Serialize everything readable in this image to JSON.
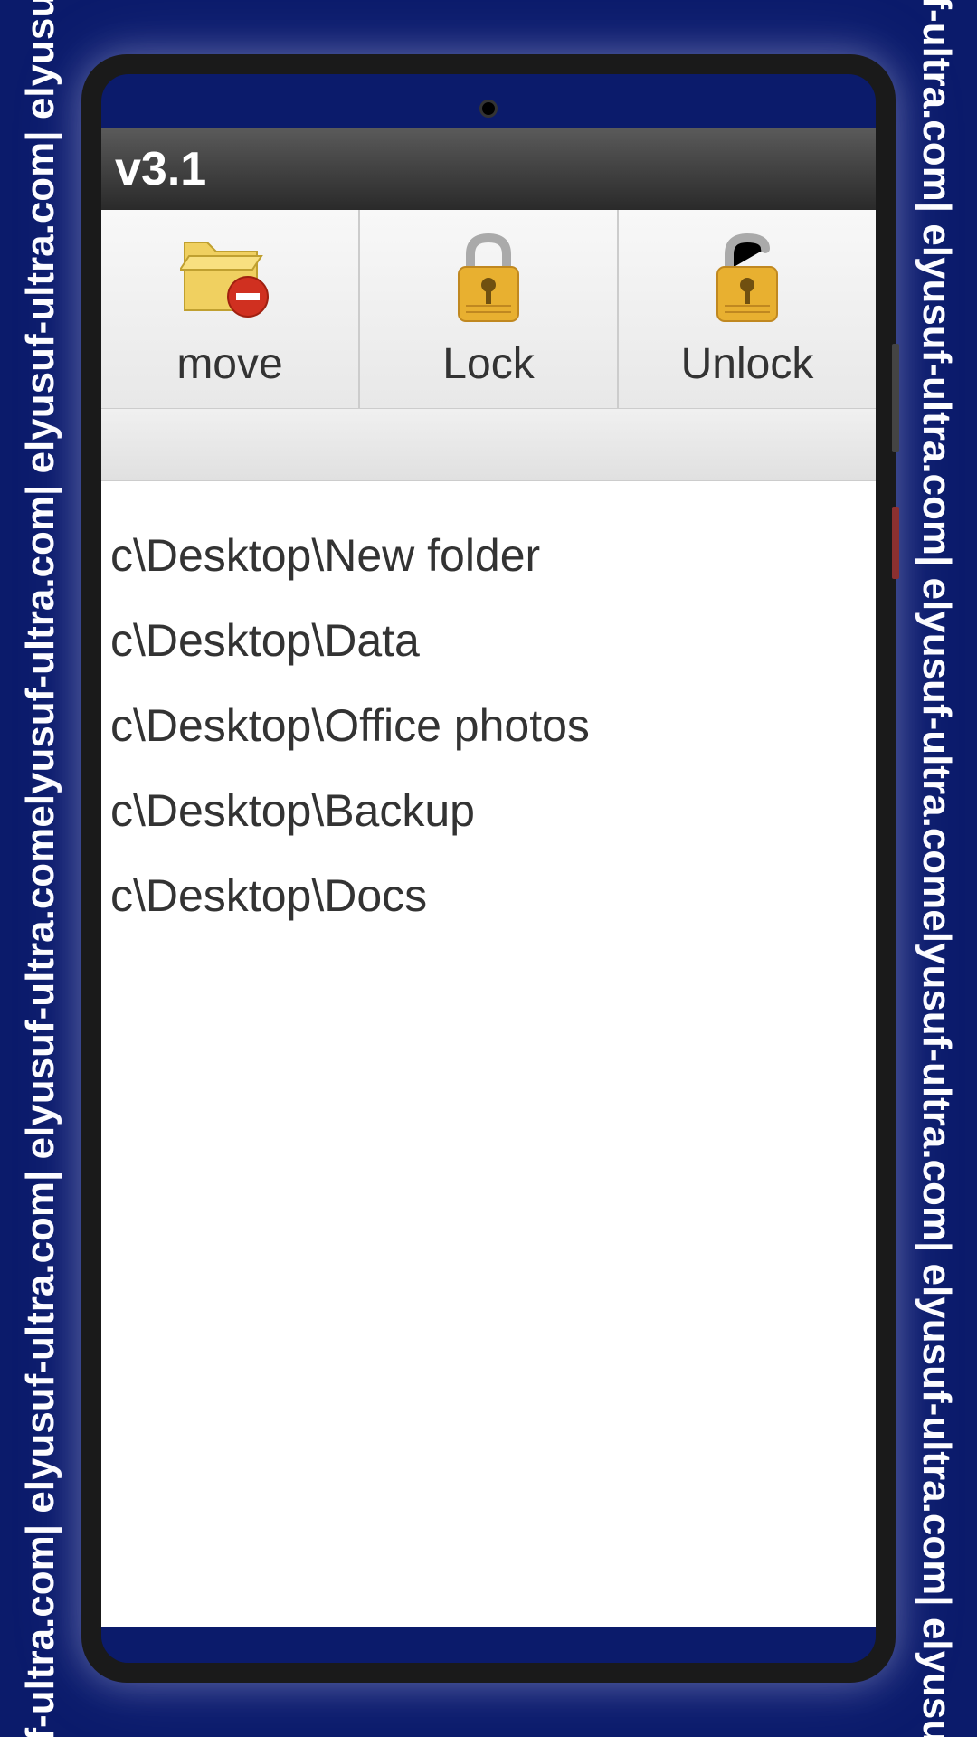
{
  "watermark": "elyusuf-ultra.com| elyusuf-ultra.com| elyusuf-ultra.comelyusuf-ultra.com| elyusuf-ultra.com| elyusuf-ultra.",
  "title_bar": "v3.1",
  "toolbar": {
    "remove_label": "move",
    "lock_label": "Lock",
    "unlock_label": "Unlock"
  },
  "file_list": [
    "c\\Desktop\\New folder",
    "c\\Desktop\\Data",
    "c\\Desktop\\Office photos",
    "c\\Desktop\\Backup",
    "c\\Desktop\\Docs"
  ]
}
